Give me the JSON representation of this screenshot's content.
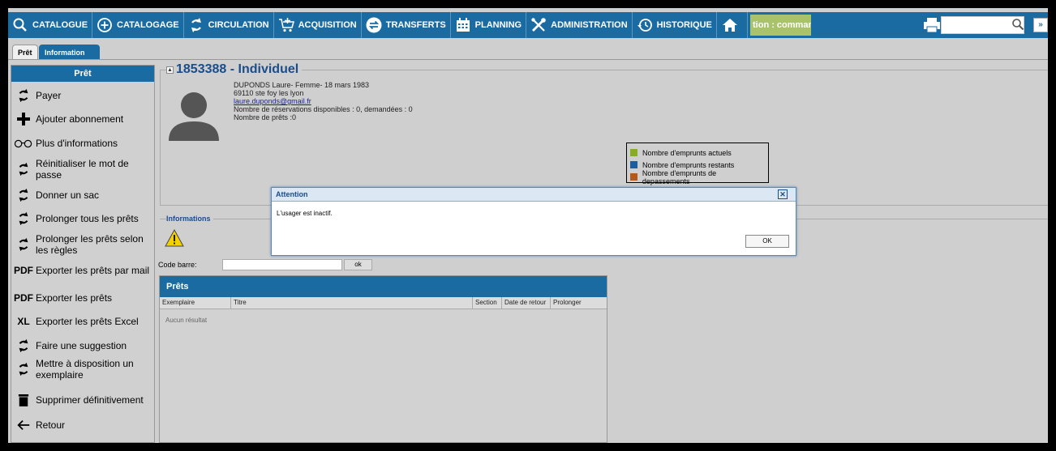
{
  "nav": {
    "catalogue": "CATALOGUE",
    "catalogage": "CATALOGAGE",
    "circulation": "CIRCULATION",
    "acquisition": "ACQUISITION",
    "transferts": "TRANSFERTS",
    "planning": "PLANNING",
    "administration": "ADMINISTRATION",
    "historique": "HISTORIQUE",
    "tooltip": "tion : comman..",
    "more": "»"
  },
  "tabs": {
    "pret": "Prêt",
    "information": "Information"
  },
  "sidebar": {
    "title": "Prêt",
    "items": [
      {
        "label": "Payer",
        "icon": "refresh-icon"
      },
      {
        "label": "Ajouter abonnement",
        "icon": "plus-icon"
      },
      {
        "label": "Plus d'informations",
        "icon": "glasses-icon"
      },
      {
        "label": "Réinitialiser le mot de passe",
        "icon": "refresh-icon"
      },
      {
        "label": "Donner un sac",
        "icon": "refresh-icon"
      },
      {
        "label": "Prolonger tous les prêts",
        "icon": "refresh-icon"
      },
      {
        "label": "Prolonger les prêts selon les règles",
        "icon": "refresh-icon"
      },
      {
        "label": "Exporter les prêts par mail",
        "icon": "pdf-icon",
        "icon_text": "PDF"
      },
      {
        "label": "Exporter les prêts",
        "icon": "pdf-icon",
        "icon_text": "PDF"
      },
      {
        "label": "Exporter les prêts Excel",
        "icon": "excel-icon",
        "icon_text": "XL"
      },
      {
        "label": "Faire une suggestion",
        "icon": "refresh-icon"
      },
      {
        "label": "Mettre à disposition un exemplaire",
        "icon": "refresh-icon"
      },
      {
        "label": "Supprimer définitivement",
        "icon": "trash-icon"
      },
      {
        "label": "Retour",
        "icon": "arrow-left-icon"
      }
    ]
  },
  "patron": {
    "title": "1853388 - Individuel",
    "line1": "DUPONDS Laure- Femme- 18 mars 1983",
    "line2": "69110 ste foy les lyon",
    "email": "laure.duponds@gmail.fr",
    "line4": "Nombre de réservations disponibles : 0, demandées : 0",
    "line5": "Nombre de prêts :0"
  },
  "chart_legend": [
    {
      "label": "Nombre d'emprunts actuels",
      "color": "#8cab24"
    },
    {
      "label": "Nombre d'emprunts restants",
      "color": "#1b5fa0"
    },
    {
      "label": "Nombre d'emprunts de depassements",
      "color": "#b5581c"
    }
  ],
  "informations_title": "Informations",
  "barcode": {
    "label": "Code barre:",
    "ok": "ok"
  },
  "prets": {
    "title": "Prêts",
    "columns": [
      "Exemplaire",
      "Titre",
      "Section",
      "Date de retour",
      "Prolonger"
    ],
    "empty": "Aucun résultat"
  },
  "modal": {
    "title": "Attention",
    "message": "L'usager est inactif.",
    "ok": "OK",
    "close": "✕"
  },
  "colors": {
    "brand": "#1b6ba3",
    "tooltip_bg": "#a8c36a"
  }
}
